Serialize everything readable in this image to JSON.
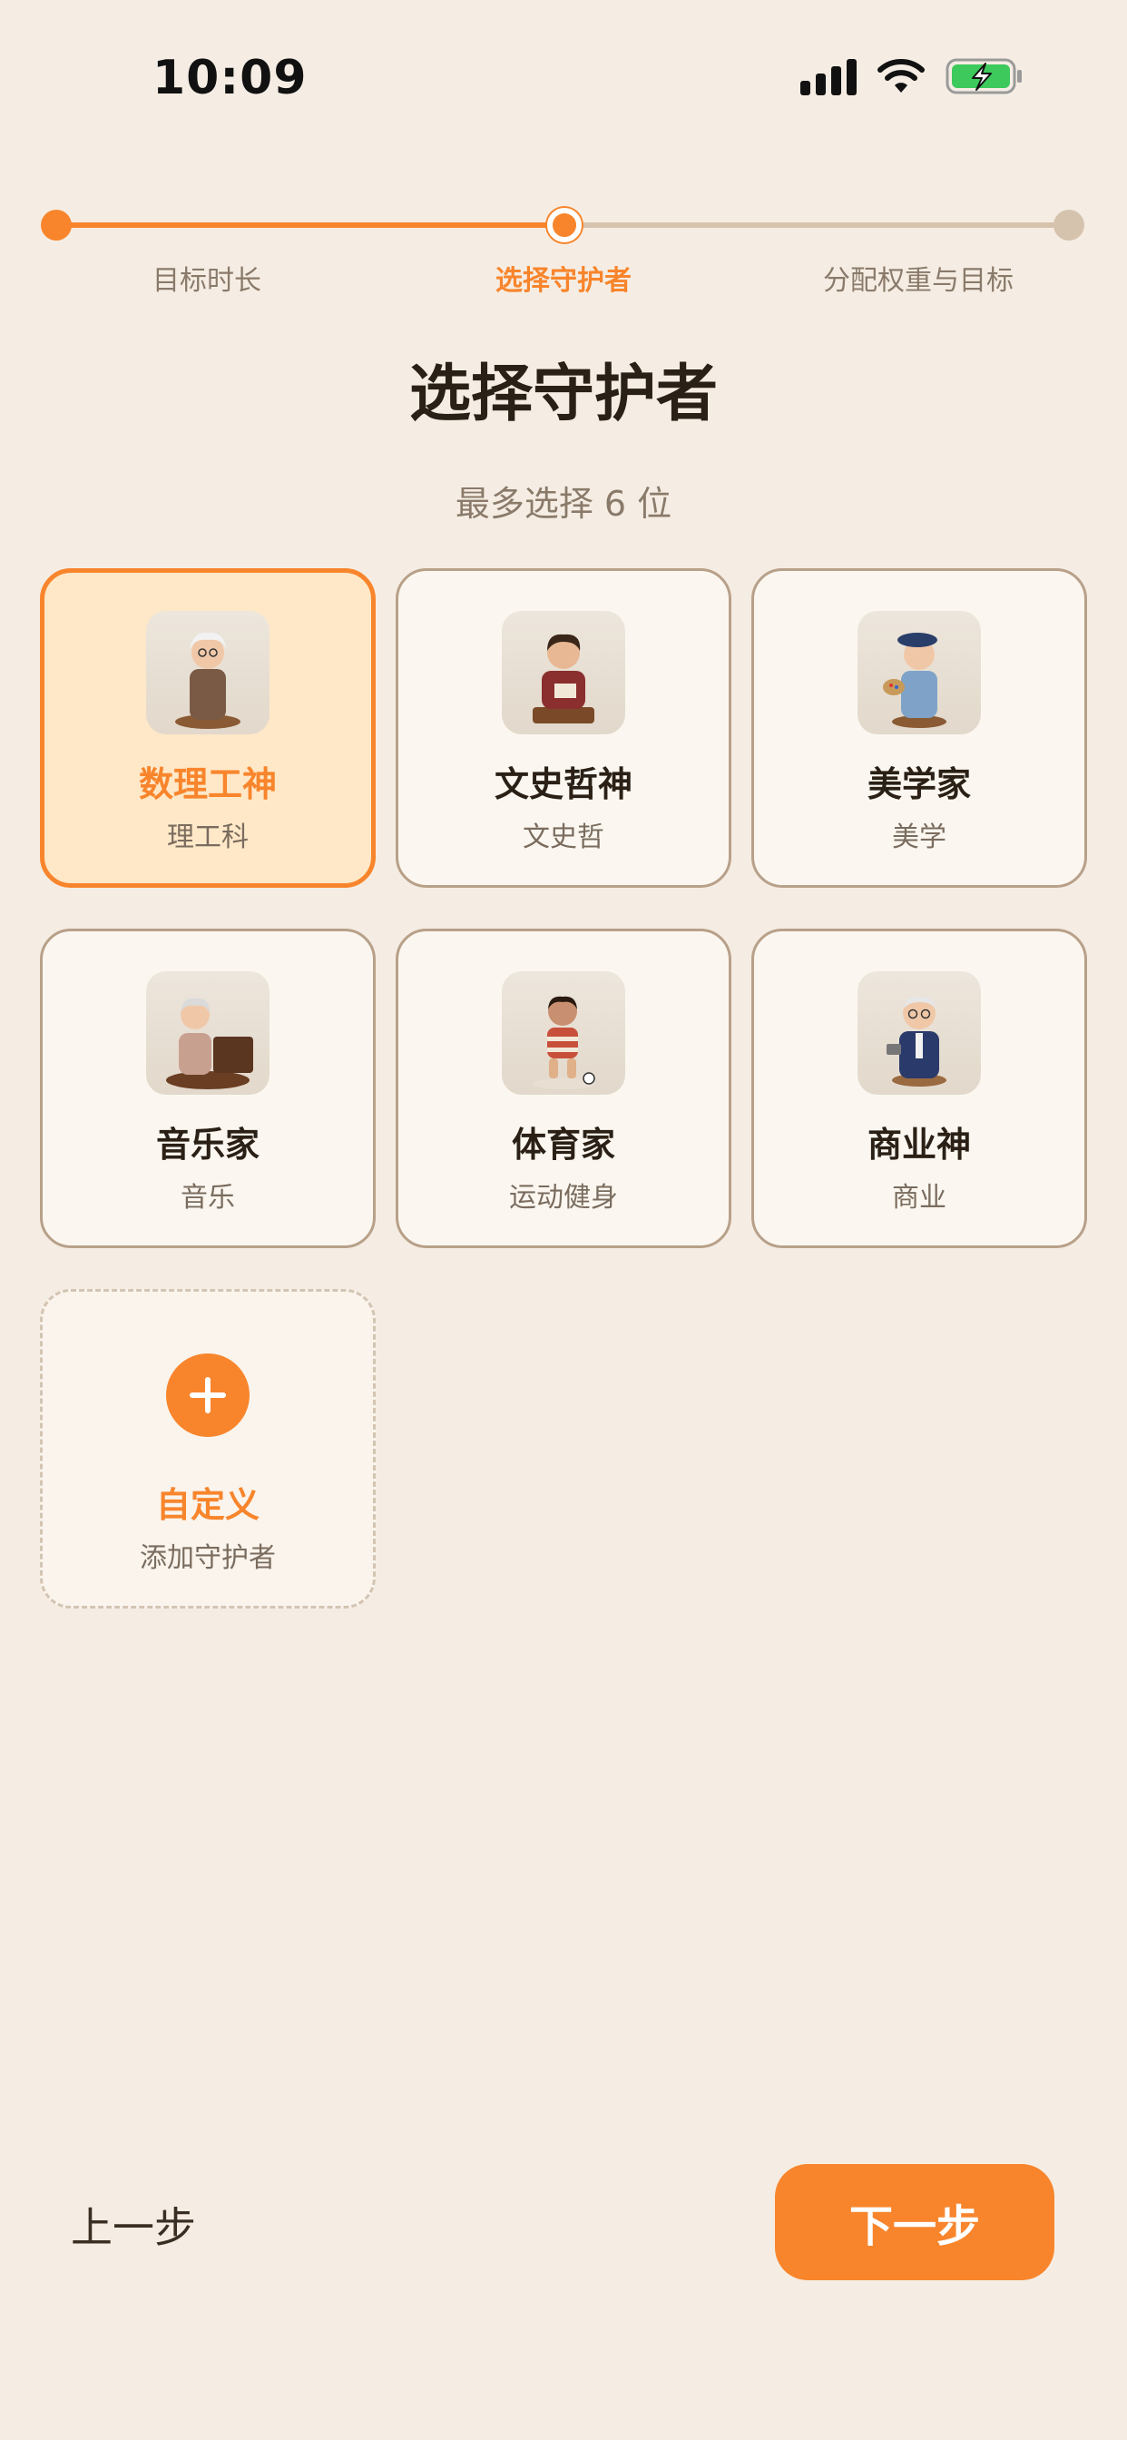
{
  "status_bar": {
    "time": "10:09"
  },
  "stepper": {
    "steps": [
      {
        "label": "目标时长",
        "state": "done"
      },
      {
        "label": "选择守护者",
        "state": "current"
      },
      {
        "label": "分配权重与目标",
        "state": "todo"
      }
    ]
  },
  "header": {
    "title": "选择守护者",
    "subtitle": "最多选择 6 位"
  },
  "guardians": [
    {
      "name": "数理工神",
      "category": "理工科",
      "selected": true
    },
    {
      "name": "文史哲神",
      "category": "文史哲",
      "selected": false
    },
    {
      "name": "美学家",
      "category": "美学",
      "selected": false
    },
    {
      "name": "音乐家",
      "category": "音乐",
      "selected": false
    },
    {
      "name": "体育家",
      "category": "运动健身",
      "selected": false
    },
    {
      "name": "商业神",
      "category": "商业",
      "selected": false
    }
  ],
  "custom": {
    "title": "自定义",
    "subtitle": "添加守护者"
  },
  "nav": {
    "back_label": "上一步",
    "next_label": "下一步"
  },
  "colors": {
    "accent": "#F8852C",
    "background": "#F5EDE3",
    "selected_card": "#FFE8C8"
  }
}
